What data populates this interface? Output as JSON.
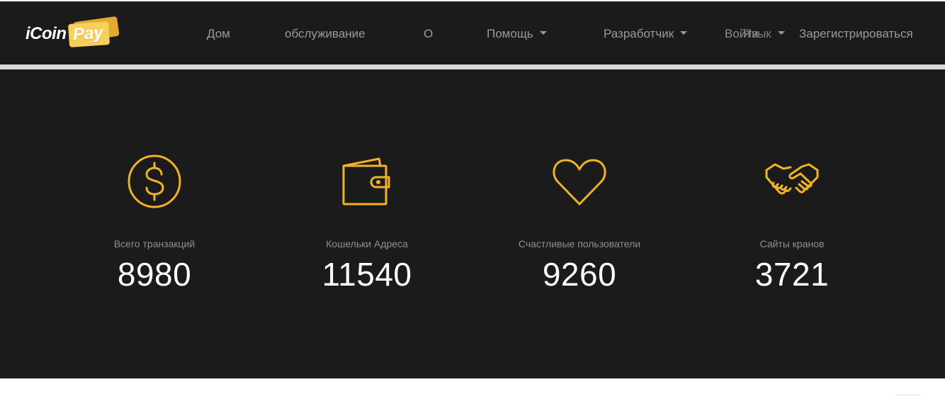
{
  "header": {
    "logo": {
      "part1": "iCoin",
      "part2": "Pay"
    },
    "nav": [
      {
        "label": "Дом",
        "dropdown": false
      },
      {
        "label": "обслуживание",
        "dropdown": false
      },
      {
        "label": "О",
        "dropdown": false
      },
      {
        "label": "Помощь",
        "dropdown": true
      },
      {
        "label": "Разработчик",
        "dropdown": true
      },
      {
        "label": "Язык",
        "dropdown": true
      },
      {
        "label": "Войти",
        "dropdown": false
      },
      {
        "label": "Зарегистрироваться",
        "dropdown": false
      }
    ]
  },
  "stats": [
    {
      "icon": "dollar-coin-icon",
      "label": "Всего транзакций",
      "value": "8980"
    },
    {
      "icon": "wallet-icon",
      "label": "Кошельки Адреса",
      "value": "11540"
    },
    {
      "icon": "heart-icon",
      "label": "Счастливые пользователи",
      "value": "9260"
    },
    {
      "icon": "handshake-icon",
      "label": "Сайты кранов",
      "value": "3721"
    }
  ],
  "colors": {
    "background": "#1b1b1b",
    "accent": "#f2b224",
    "nav_text": "#9a9a9a",
    "label_text": "#8f8f8f",
    "value_text": "#ffffff"
  }
}
